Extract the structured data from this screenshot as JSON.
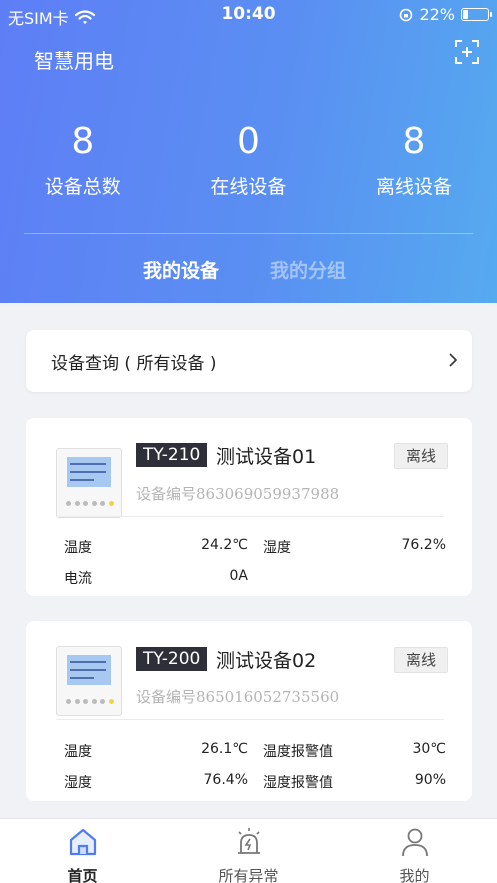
{
  "status_bar": {
    "carrier": "无SIM卡",
    "time": "10:40",
    "battery": "22%",
    "battery_level": 0.22
  },
  "header": {
    "title": "智慧用电",
    "stats": [
      {
        "value": "8",
        "label": "设备总数"
      },
      {
        "value": "0",
        "label": "在线设备"
      },
      {
        "value": "8",
        "label": "离线设备"
      }
    ],
    "tabs": [
      {
        "label": "我的设备",
        "active": true
      },
      {
        "label": "我的分组",
        "active": false
      }
    ]
  },
  "query": {
    "label": "设备查询 ( 所有设备 )"
  },
  "devices": [
    {
      "model": "TY-210",
      "name": "测试设备01",
      "status": "离线",
      "code": "设备编号863069059937988",
      "metrics": [
        {
          "label": "温度",
          "value": "24.2℃"
        },
        {
          "label": "湿度",
          "value": "76.2%"
        },
        {
          "label": "电流",
          "value": "0A"
        }
      ]
    },
    {
      "model": "TY-200",
      "name": "测试设备02",
      "status": "离线",
      "code": "设备编号865016052735560",
      "metrics": [
        {
          "label": "温度",
          "value": "26.1℃"
        },
        {
          "label": "温度报警值",
          "value": "30℃"
        },
        {
          "label": "湿度",
          "value": "76.4%"
        },
        {
          "label": "湿度报警值",
          "value": "90%"
        }
      ]
    }
  ],
  "bottom_nav": [
    {
      "label": "首页",
      "icon": "home-icon",
      "active": true
    },
    {
      "label": "所有异常",
      "icon": "alarm-icon",
      "active": false
    },
    {
      "label": "我的",
      "icon": "user-icon",
      "active": false
    }
  ],
  "colors": {
    "header_start": "#5e7ef6",
    "header_end": "#55aaf0",
    "nav_active": "#4f7cf3"
  }
}
